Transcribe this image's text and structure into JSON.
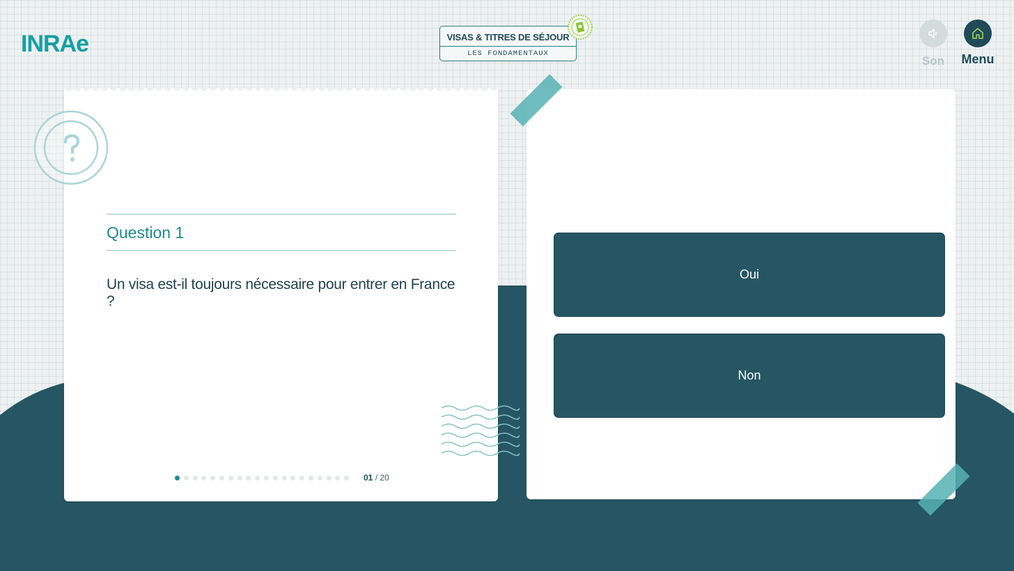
{
  "header": {
    "logo": "INRAe",
    "title_line1": "VISAS & TITRES DE SÉJOUR",
    "title_line2": "LES FONDAMENTAUX",
    "sound_label": "Son",
    "menu_label": "Menu"
  },
  "question": {
    "label": "Question 1",
    "text": "Un visa est-il toujours nécessaire pour entrer en France ?",
    "current": "01",
    "total": "/ 20",
    "current_index": 1,
    "count": 20
  },
  "answers": [
    {
      "label": "Oui"
    },
    {
      "label": "Non"
    }
  ],
  "colors": {
    "dark_teal": "#265663",
    "accent_teal": "#1b8a90",
    "logo_teal": "#12a0a4",
    "stamp_green": "#8cc43c"
  },
  "icons": {
    "sound": "speaker-icon",
    "menu": "home-icon",
    "question": "question-mark-stamp-icon",
    "stamp": "passport-stamp-icon",
    "waves": "postmark-waves-icon"
  }
}
